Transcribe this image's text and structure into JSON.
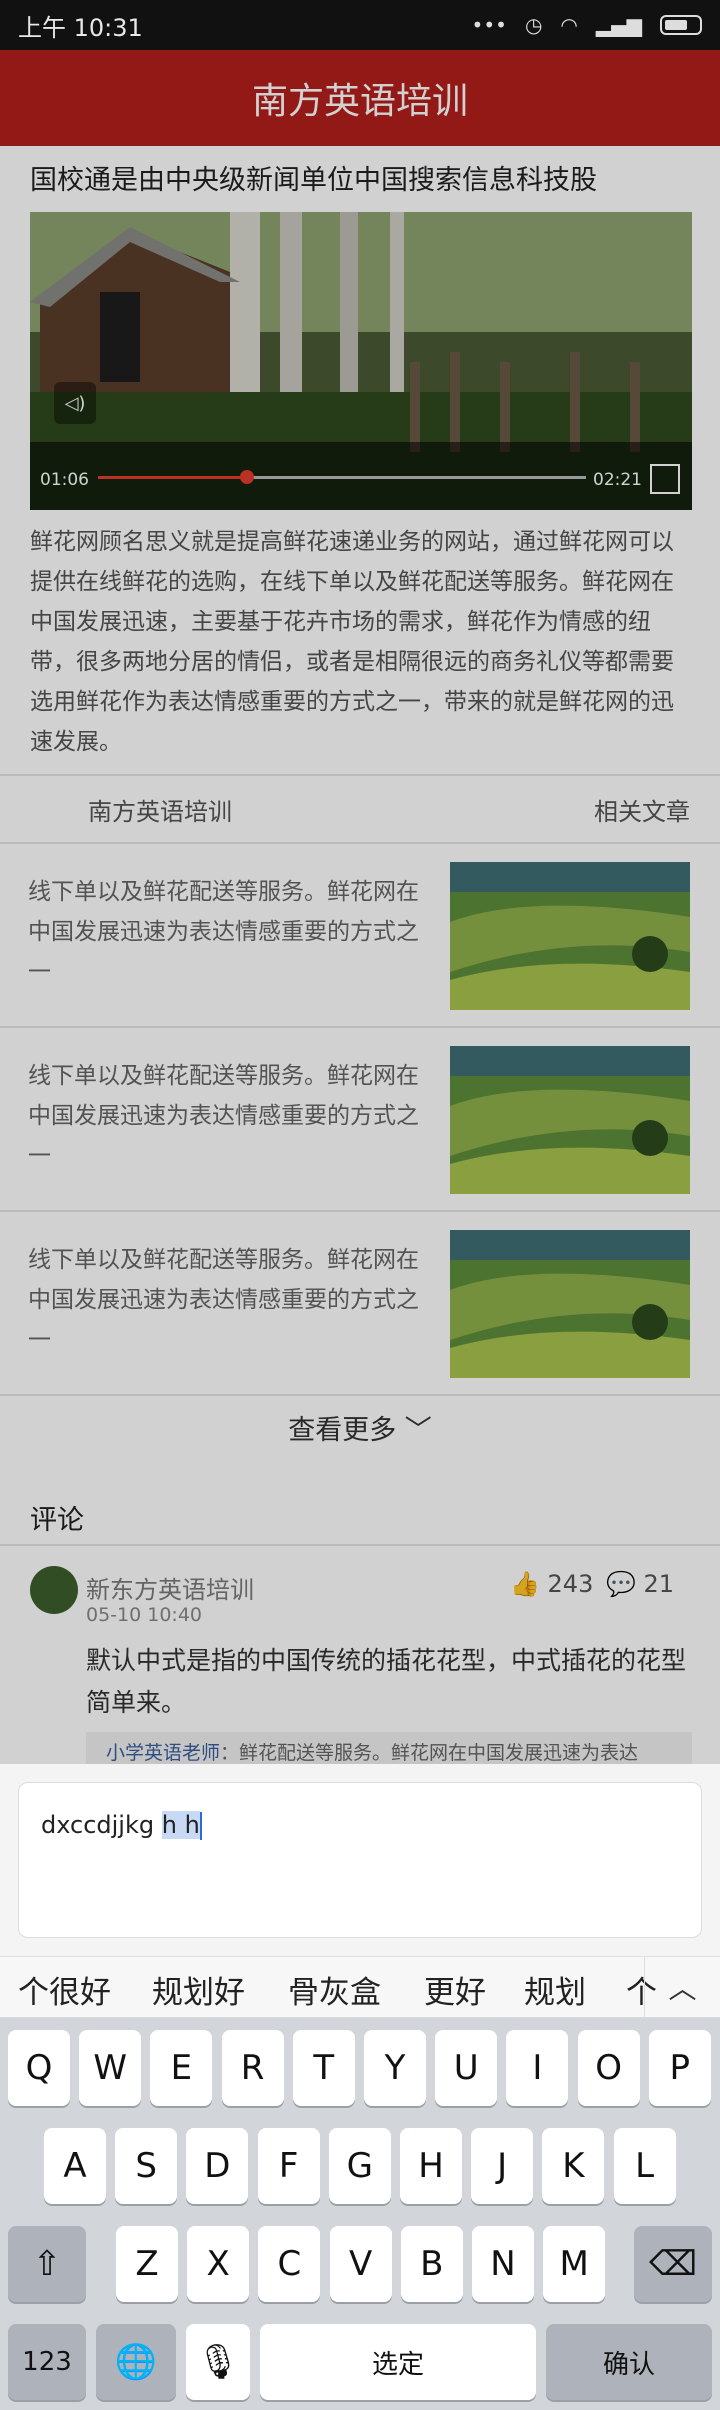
{
  "status": {
    "time": "上午 10:31"
  },
  "header": {
    "title": "南方英语培训"
  },
  "article": {
    "headline": "国校通是由中央级新闻单位中国搜索信息科技股",
    "video": {
      "current_time": "01:06",
      "duration": "02:21",
      "progress": 0.305
    },
    "body": "鲜花网顾名思义就是提高鲜花速递业务的网站，通过鲜花网可以提供在线鲜花的选购，在线下单以及鲜花配送等服务。鲜花网在中国发展迅速，主要基于花卉市场的需求，鲜花作为情感的纽带，很多两地分居的情侣，或者是相隔很远的商务礼仪等都需要选用鲜花作为表达情感重要的方式之一，带来的就是鲜花网的迅速发展。"
  },
  "tabs": {
    "left": "南方英语培训",
    "right": "相关文章"
  },
  "related": [
    {
      "text": "线下单以及鲜花配送等服务。鲜花网在中国发展迅速为表达情感重要的方式之一"
    },
    {
      "text": "线下单以及鲜花配送等服务。鲜花网在中国发展迅速为表达情感重要的方式之一"
    },
    {
      "text": "线下单以及鲜花配送等服务。鲜花网在中国发展迅速为表达情感重要的方式之一"
    }
  ],
  "more_label": "查看更多",
  "comments": {
    "title": "评论",
    "items": [
      {
        "user": "新东方英语培训",
        "date": "05-10  10:40",
        "likes": "243",
        "replies": "21",
        "text": "默认中式是指的中国传统的插花花型，中式插花的花型简单来。",
        "quote_author": "小学英语老师",
        "quote_text": "：鲜花配送等服务。鲜花网在中国发展迅速为表达"
      }
    ]
  },
  "composer": {
    "text_before": "dxccdjjkg ",
    "text_selected": "h h"
  },
  "suggestions": [
    "个很好",
    "规划好",
    "骨灰盒",
    "更好",
    "规划",
    "个"
  ],
  "keyboard": {
    "row1": [
      "Q",
      "W",
      "E",
      "R",
      "T",
      "Y",
      "U",
      "I",
      "O",
      "P"
    ],
    "row2": [
      "A",
      "S",
      "D",
      "F",
      "G",
      "H",
      "J",
      "K",
      "L"
    ],
    "row3": [
      "Z",
      "X",
      "C",
      "V",
      "B",
      "N",
      "M"
    ],
    "num_key": "123",
    "space_key": "选定",
    "confirm_key": "确认"
  }
}
